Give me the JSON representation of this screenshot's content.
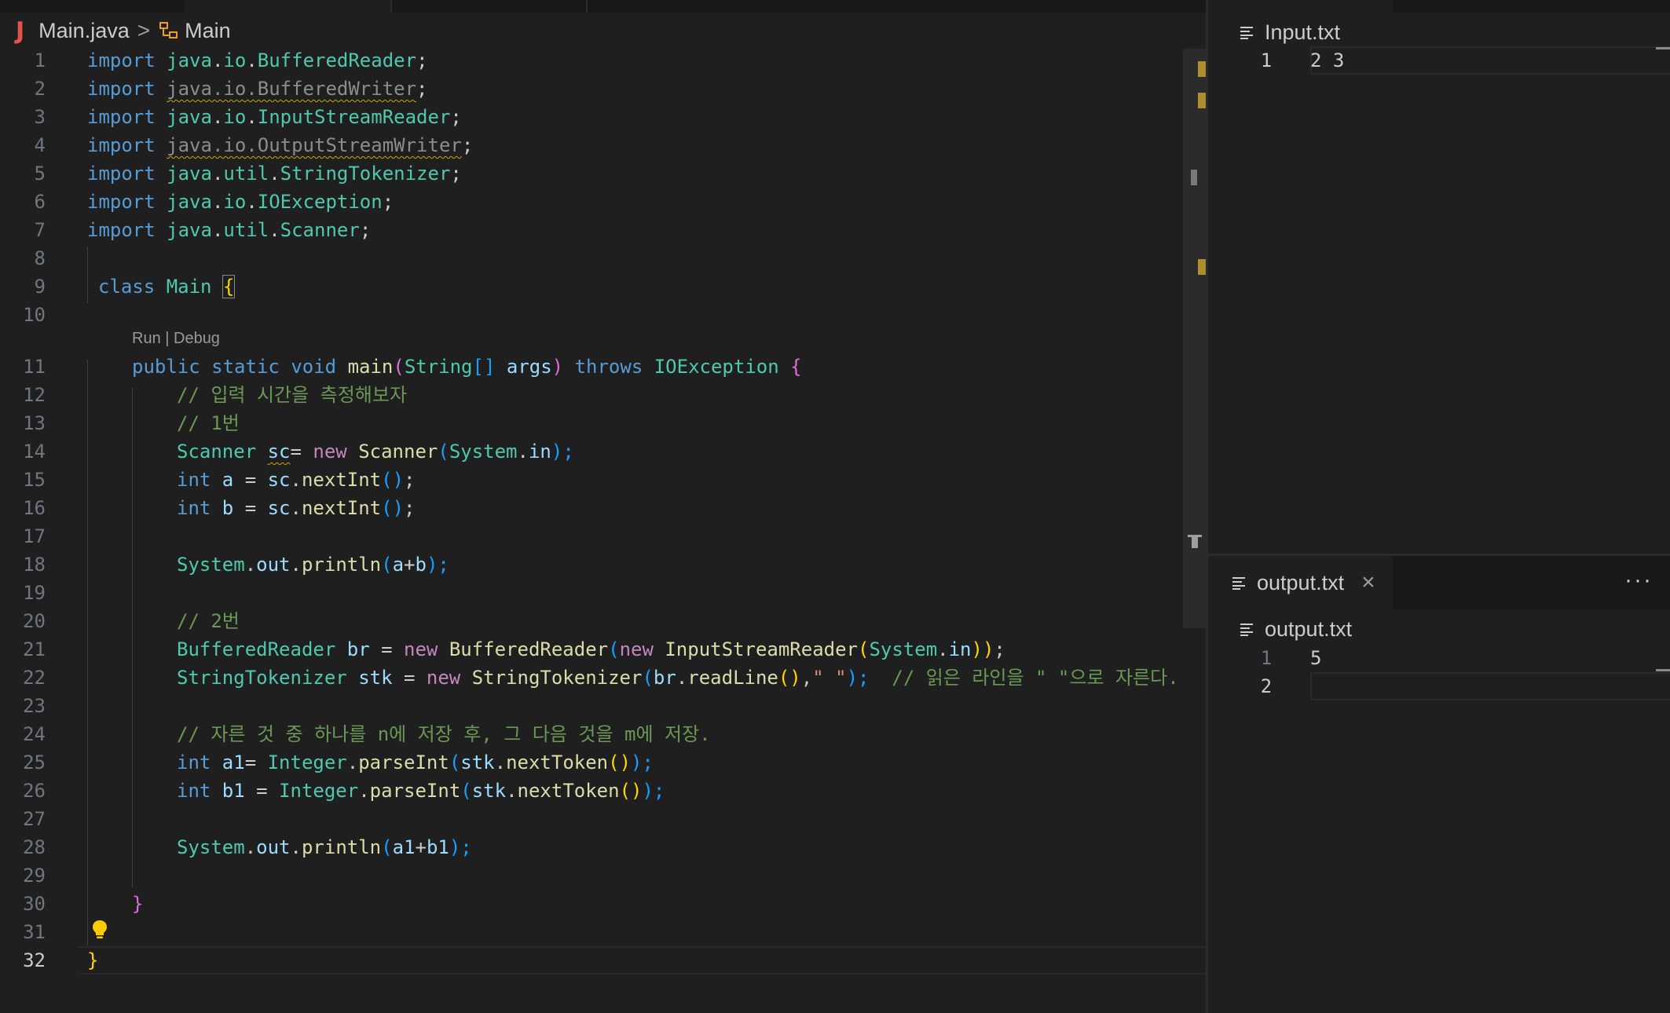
{
  "breadcrumb": {
    "file_icon": "J",
    "file": "Main.java",
    "separator": ">",
    "symbol": "Main"
  },
  "editor": {
    "codelens": "Run | Debug",
    "line_numbers": [
      "1",
      "2",
      "3",
      "4",
      "5",
      "6",
      "7",
      "8",
      "9",
      "10",
      "11",
      "12",
      "13",
      "14",
      "15",
      "16",
      "17",
      "18",
      "19",
      "20",
      "21",
      "22",
      "23",
      "24",
      "25",
      "26",
      "27",
      "28",
      "29",
      "30",
      "31",
      "32"
    ],
    "current_line": "32",
    "code": {
      "l1": [
        "import ",
        "java",
        ".",
        "io",
        ".",
        "BufferedReader",
        ";"
      ],
      "l2": [
        "import ",
        "java.io.BufferedWriter",
        ";"
      ],
      "l3": [
        "import ",
        "java",
        ".",
        "io",
        ".",
        "InputStreamReader",
        ";"
      ],
      "l4": [
        "import ",
        "java.io.OutputStreamWriter",
        ";"
      ],
      "l5": [
        "import ",
        "java",
        ".",
        "util",
        ".",
        "StringTokenizer",
        ";"
      ],
      "l6": [
        "import ",
        "java",
        ".",
        "io",
        ".",
        "IOException",
        ";"
      ],
      "l7": [
        "import ",
        "java",
        ".",
        "util",
        ".",
        "Scanner",
        ";"
      ],
      "l9": [
        "class ",
        "Main",
        " ",
        "{"
      ],
      "l11": [
        "public ",
        "static ",
        "void ",
        "main",
        "(",
        "String",
        "[] ",
        "args",
        ") ",
        "throws ",
        "IOException",
        " {"
      ],
      "l12": [
        "// 입력 시간을 측정해보자"
      ],
      "l13": [
        "// 1번"
      ],
      "l14": [
        "Scanner ",
        "sc",
        "= ",
        "new ",
        "Scanner",
        "(",
        "System",
        ".",
        "in",
        ");"
      ],
      "l15": [
        "int ",
        "a",
        " = ",
        "sc",
        ".",
        "nextInt",
        "()",
        ";"
      ],
      "l16": [
        "int ",
        "b",
        " = ",
        "sc",
        ".",
        "nextInt",
        "()",
        ";"
      ],
      "l18": [
        "System",
        ".",
        "out",
        ".",
        "println",
        "(",
        "a",
        "+",
        "b",
        ");"
      ],
      "l20": [
        "// 2번"
      ],
      "l21": [
        "BufferedReader ",
        "br",
        " = ",
        "new ",
        "BufferedReader",
        "(",
        "new ",
        "InputStreamReader",
        "(",
        "System",
        ".",
        "in",
        "))",
        ";"
      ],
      "l22": [
        "StringTokenizer ",
        "stk",
        " = ",
        "new ",
        "StringTokenizer",
        "(",
        "br",
        ".",
        "readLine",
        "()",
        ",",
        "\" \"",
        ");",
        "  // 읽은 라인을 \" \"으로 자른다."
      ],
      "l24": [
        "// 자른 것 중 하나를 n에 저장 후, 그 다음 것을 m에 저장."
      ],
      "l25": [
        "int ",
        "a1",
        "= ",
        "Integer",
        ".",
        "parseInt",
        "(",
        "stk",
        ".",
        "nextToken",
        "()",
        ");"
      ],
      "l26": [
        "int ",
        "b1",
        " = ",
        "Integer",
        ".",
        "parseInt",
        "(",
        "stk",
        ".",
        "nextToken",
        "()",
        ");"
      ],
      "l28": [
        "System",
        ".",
        "out",
        ".",
        "println",
        "(",
        "a1",
        "+",
        "b1",
        ");"
      ],
      "l30": [
        "}"
      ],
      "l32": [
        "}"
      ]
    }
  },
  "input_panel": {
    "title": "Input.txt",
    "lines": [
      {
        "n": "1",
        "text": "2 3"
      }
    ]
  },
  "output_panel": {
    "tab_label": "output.txt",
    "close": "×",
    "more": "···",
    "title": "output.txt",
    "lines": [
      {
        "n": "1",
        "text": "5"
      },
      {
        "n": "2",
        "text": ""
      }
    ]
  },
  "colors": {
    "keyword": "#569cd6",
    "type": "#4ec9b0",
    "control": "#c586c0",
    "function": "#dcdcaa",
    "variable": "#9cdcfe",
    "string": "#ce9178",
    "comment": "#6a9955",
    "warning": "#cca700"
  }
}
